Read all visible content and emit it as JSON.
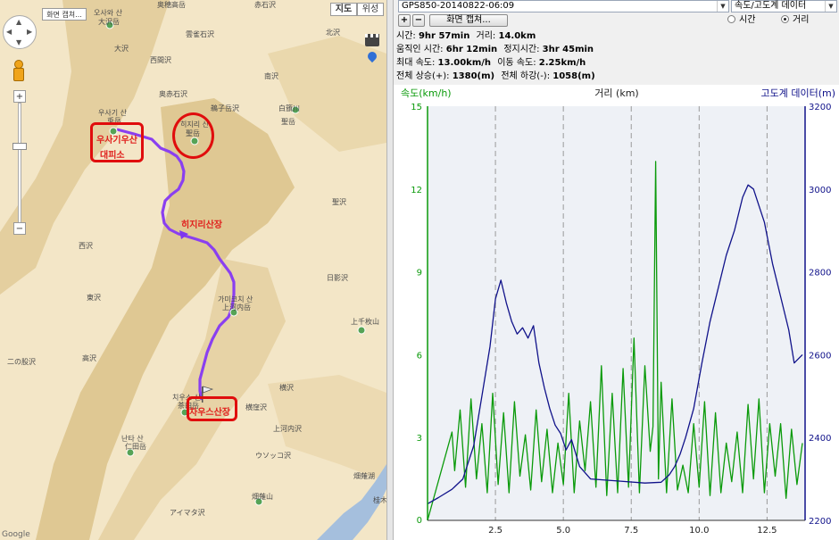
{
  "map": {
    "capture_button": "화면 캡쳐...",
    "map_type_buttons": [
      "지도",
      "위성"
    ],
    "zoom_in": "+",
    "zoom_out": "−",
    "attribution": "Google",
    "labels": [
      {
        "text": "奥穂高岳"
      },
      {
        "text": "오사와 산"
      },
      {
        "text": "大沢岳"
      },
      {
        "text": "雲雀石沢"
      },
      {
        "text": "西間沢"
      },
      {
        "text": "大沢"
      },
      {
        "text": "奥赤石沢"
      },
      {
        "text": "赤石沢"
      },
      {
        "text": "南沢"
      },
      {
        "text": "白籏川"
      },
      {
        "text": "鵜子岳沢"
      },
      {
        "text": "聖岳"
      },
      {
        "text": "우사기 산"
      },
      {
        "text": "兎岳"
      },
      {
        "text": "히지리 산"
      },
      {
        "text": "聖岳"
      },
      {
        "text": "西沢"
      },
      {
        "text": "東沢"
      },
      {
        "text": "二の股沢"
      },
      {
        "text": "高沢"
      },
      {
        "text": "가미코치 산"
      },
      {
        "text": "上河内岳"
      },
      {
        "text": "日影沢"
      },
      {
        "text": "上千枚山"
      },
      {
        "text": "茶臼岳"
      },
      {
        "text": "치우스 산"
      },
      {
        "text": "横沢"
      },
      {
        "text": "横窪沢"
      },
      {
        "text": "上河内沢"
      },
      {
        "text": "ウソッコ沢"
      },
      {
        "text": "난타 산"
      },
      {
        "text": "仁田岳"
      },
      {
        "text": "畑薙湖"
      },
      {
        "text": "畑薙山"
      },
      {
        "text": "アイマタ沢"
      },
      {
        "text": "桂木"
      },
      {
        "text": "北沢"
      },
      {
        "text": "聖沢"
      }
    ],
    "annotations": [
      {
        "text": "우사기우산"
      },
      {
        "text": "대피소"
      },
      {
        "text": "히지리산장"
      },
      {
        "text": "차우스산장"
      }
    ]
  },
  "panel": {
    "file_select": "GPS850-20140822-06:09",
    "view_select": "속도/고도계 데이터",
    "zoom_in": "+",
    "zoom_out": "−",
    "capture_button": "화면 캡쳐...",
    "radio_time": "시간",
    "radio_distance": "거리",
    "radio_selected": "distance",
    "stats": [
      {
        "label1": "시간:",
        "value1": "9hr 57min",
        "label2": "거리:",
        "value2": "14.0km"
      },
      {
        "label1": "움직인 시간:",
        "value1": "6hr 12min",
        "label2": "정지시간:",
        "value2": "3hr 45min"
      },
      {
        "label1": "최대 속도:",
        "value1": "13.00km/h",
        "label2": "이동 속도:",
        "value2": "2.25km/h"
      },
      {
        "label1": "전체 상승(+):",
        "value1": "1380(m)",
        "label2": "전체 하강(-):",
        "value2": "1058(m)"
      }
    ]
  },
  "chart_data": {
    "type": "line",
    "title": "",
    "xlabel": "거리 (km)",
    "ylabel_left": "속도(km/h)",
    "ylabel_right": "고도계 데이터(m)",
    "xlim": [
      0,
      13.9
    ],
    "xticks": [
      "2.5",
      "5.0",
      "7.5",
      "10.0",
      "12.5"
    ],
    "ylim_left": [
      0,
      15
    ],
    "yticks_left": [
      "3",
      "6",
      "9",
      "12",
      "15"
    ],
    "ylim_right": [
      2200,
      3200
    ],
    "yticks_right": [
      "2200",
      "2400",
      "2600",
      "2800",
      "3000",
      "3200"
    ],
    "grid": "vertical dashed",
    "colors": {
      "speed": "#0a9a0a",
      "altitude": "#10128a",
      "left_axis_text": "#0a9a0a",
      "right_axis_text": "#10128a"
    },
    "series": [
      {
        "name": "속도",
        "axis": "left",
        "x": [
          0.0,
          0.9,
          1.0,
          1.2,
          1.4,
          1.6,
          1.8,
          2.0,
          2.2,
          2.4,
          2.6,
          2.8,
          3.0,
          3.2,
          3.4,
          3.6,
          3.8,
          4.0,
          4.2,
          4.4,
          4.6,
          4.8,
          5.0,
          5.2,
          5.4,
          5.6,
          5.8,
          6.0,
          6.2,
          6.4,
          6.6,
          6.8,
          7.0,
          7.2,
          7.4,
          7.6,
          7.8,
          8.0,
          8.2,
          8.3,
          8.4,
          8.5,
          8.6,
          8.8,
          9.0,
          9.2,
          9.4,
          9.6,
          9.8,
          10.0,
          10.2,
          10.4,
          10.6,
          10.8,
          11.0,
          11.2,
          11.4,
          11.6,
          11.8,
          12.0,
          12.2,
          12.4,
          12.6,
          12.8,
          13.0,
          13.2,
          13.4,
          13.6,
          13.8
        ],
        "values": [
          0.0,
          3.2,
          1.8,
          4.0,
          1.2,
          4.4,
          1.5,
          3.5,
          1.0,
          4.6,
          1.3,
          3.9,
          1.0,
          4.3,
          1.6,
          3.1,
          1.1,
          4.0,
          1.4,
          3.3,
          1.0,
          2.8,
          1.3,
          4.6,
          1.0,
          3.6,
          1.8,
          4.3,
          1.2,
          5.6,
          0.9,
          4.6,
          1.0,
          5.5,
          1.2,
          6.6,
          1.0,
          5.6,
          2.5,
          3.4,
          13.0,
          1.5,
          5.0,
          1.0,
          4.4,
          1.1,
          2.0,
          1.0,
          3.5,
          1.2,
          4.3,
          0.9,
          3.9,
          1.0,
          2.8,
          1.4,
          3.2,
          1.0,
          4.2,
          1.5,
          4.4,
          1.0,
          3.5,
          1.6,
          3.5,
          0.8,
          3.3,
          1.3,
          2.8
        ]
      },
      {
        "name": "고도계 데이터",
        "axis": "right",
        "x": [
          0.0,
          0.4,
          0.9,
          1.3,
          1.7,
          2.0,
          2.3,
          2.5,
          2.7,
          2.9,
          3.1,
          3.3,
          3.5,
          3.7,
          3.9,
          4.1,
          4.3,
          4.5,
          4.7,
          4.9,
          5.1,
          5.3,
          5.6,
          6.0,
          7.0,
          8.0,
          8.6,
          8.9,
          9.1,
          9.3,
          9.5,
          9.8,
          10.1,
          10.4,
          10.7,
          11.0,
          11.3,
          11.6,
          11.8,
          12.0,
          12.2,
          12.4,
          12.7,
          13.0,
          13.3,
          13.5,
          13.8
        ],
        "values": [
          2240,
          2255,
          2275,
          2300,
          2380,
          2500,
          2620,
          2735,
          2780,
          2725,
          2680,
          2650,
          2665,
          2640,
          2670,
          2580,
          2520,
          2470,
          2430,
          2410,
          2370,
          2395,
          2330,
          2300,
          2295,
          2290,
          2292,
          2310,
          2330,
          2360,
          2400,
          2470,
          2580,
          2680,
          2760,
          2840,
          2900,
          2980,
          3010,
          3000,
          2960,
          2920,
          2820,
          2740,
          2660,
          2580,
          2600
        ]
      }
    ]
  }
}
